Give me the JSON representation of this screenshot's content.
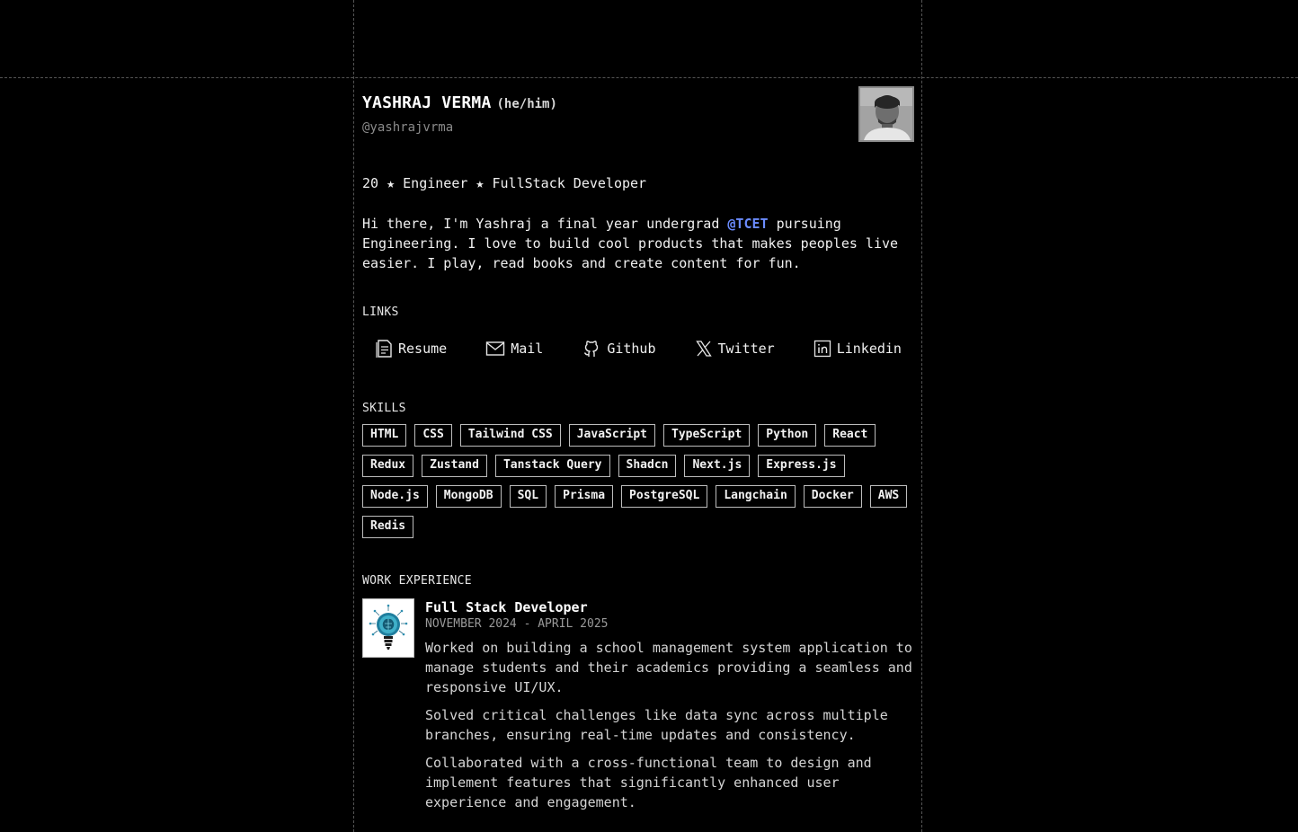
{
  "profile": {
    "name": "YASHRAJ VERMA",
    "pronouns": "(he/him)",
    "handle": "@yashrajvrma",
    "avatar_alt": "avatar"
  },
  "tagline": "20 ★ Engineer ★ FullStack Developer",
  "bio": {
    "before": "Hi there, I'm Yashraj a final year undergrad ",
    "mention": "@TCET",
    "after": " pursuing Engineering. I love to build cool products that makes peoples live easier. I play, read books and create content for fun."
  },
  "links": {
    "title": "LINKS",
    "items": [
      {
        "label": "Resume",
        "icon": "file-icon"
      },
      {
        "label": "Mail",
        "icon": "mail-icon"
      },
      {
        "label": "Github",
        "icon": "github-icon"
      },
      {
        "label": "Twitter",
        "icon": "x-icon"
      },
      {
        "label": "Linkedin",
        "icon": "linkedin-icon"
      }
    ]
  },
  "skills": {
    "title": "SKILLS",
    "items": [
      "HTML",
      "CSS",
      "Tailwind CSS",
      "JavaScript",
      "TypeScript",
      "Python",
      "React",
      "Redux",
      "Zustand",
      "Tanstack Query",
      "Shadcn",
      "Next.js",
      "Express.js",
      "Node.js",
      "MongoDB",
      "SQL",
      "Prisma",
      "PostgreSQL",
      "Langchain",
      "Docker",
      "AWS",
      "Redis"
    ]
  },
  "work": {
    "title": "WORK EXPERIENCE",
    "jobs": [
      {
        "role": "Full Stack Developer",
        "dates": "NOVEMBER 2024 - APRIL 2025",
        "points": [
          "Worked on building a school management system application to manage students and their academics providing a seamless and responsive UI/UX.",
          "Solved critical challenges like data sync across multiple branches, ensuring real-time updates and consistency.",
          "Collaborated with a cross-functional team to design and implement features that significantly enhanced user experience and engagement."
        ]
      }
    ]
  },
  "colors": {
    "background": "#000000",
    "mention": "#6b8cff",
    "muted": "#8a8a8a"
  }
}
